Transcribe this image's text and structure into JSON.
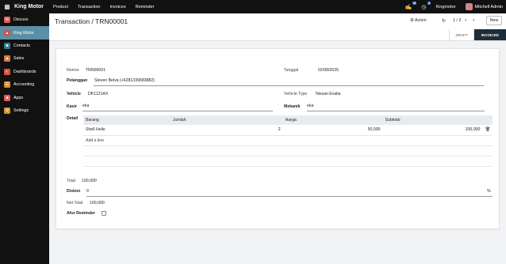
{
  "topbar": {
    "apps_icon": "grid-icon",
    "brand": "King Motor",
    "menu": [
      "Product",
      "Transaction",
      "Invoices",
      "Reminder"
    ],
    "chat_count": "5",
    "activity_count": "1",
    "company": "Kingmotor",
    "user": "Mitchell Admin"
  },
  "sidebar": {
    "items": [
      {
        "label": "Discuss",
        "icon": "discuss-icon",
        "color": "#e05c5c"
      },
      {
        "label": "King Motor",
        "icon": "king-motor-icon",
        "color": "#c25a4a"
      },
      {
        "label": "Contacts",
        "icon": "contacts-icon",
        "color": "#2d7d8f"
      },
      {
        "label": "Sales",
        "icon": "sales-icon",
        "color": "#e07a3a"
      },
      {
        "label": "Dashboards",
        "icon": "dashboards-icon",
        "color": "#d9533a"
      },
      {
        "label": "Accounting",
        "icon": "accounting-icon",
        "color": "#e08a2a"
      },
      {
        "label": "Apps",
        "icon": "apps-icon",
        "color": "#e05c5c"
      },
      {
        "label": "Settings",
        "icon": "settings-icon",
        "color": "#c99a2a"
      }
    ]
  },
  "control": {
    "breadcrumb": "Transaction / TRN00001",
    "action": "Action",
    "pager": "1 / 2",
    "new": "New",
    "status_steps": [
      "DRAFT",
      "INVOICED"
    ]
  },
  "form": {
    "nomor_label": "Nomor",
    "nomor": "TRN00001",
    "tanggal_label": "Tanggal",
    "tanggal": "02/08/2025",
    "pelanggan_label": "Pelanggan",
    "pelanggan": "Steven Belva (+6281339683882)",
    "vehicle_label": "Vehicle",
    "vehicle": "DK1121AX",
    "vehicle_type_label": "Vehicle Type",
    "vehicle_type": "Nissan Evalia",
    "kasir_label": "Kasir",
    "kasir": "eka",
    "mekanik_label": "Mekanik",
    "mekanik": "eka",
    "detail_label": "Detail",
    "table": {
      "headers": [
        "Barang",
        "Jumlah",
        "Harga",
        "Subtotal"
      ],
      "rows": [
        {
          "barang": "Shell Helix",
          "jumlah": "2",
          "harga": "50,000",
          "subtotal": "100,000"
        }
      ],
      "add_line": "Add a line"
    },
    "total_label": "Total",
    "total": "100,000",
    "diskon_label": "Diskon",
    "diskon": "0",
    "percent": "%",
    "net_total_label": "Net Total",
    "net_total": "100,000",
    "afur_label": "Afur Reminder"
  }
}
